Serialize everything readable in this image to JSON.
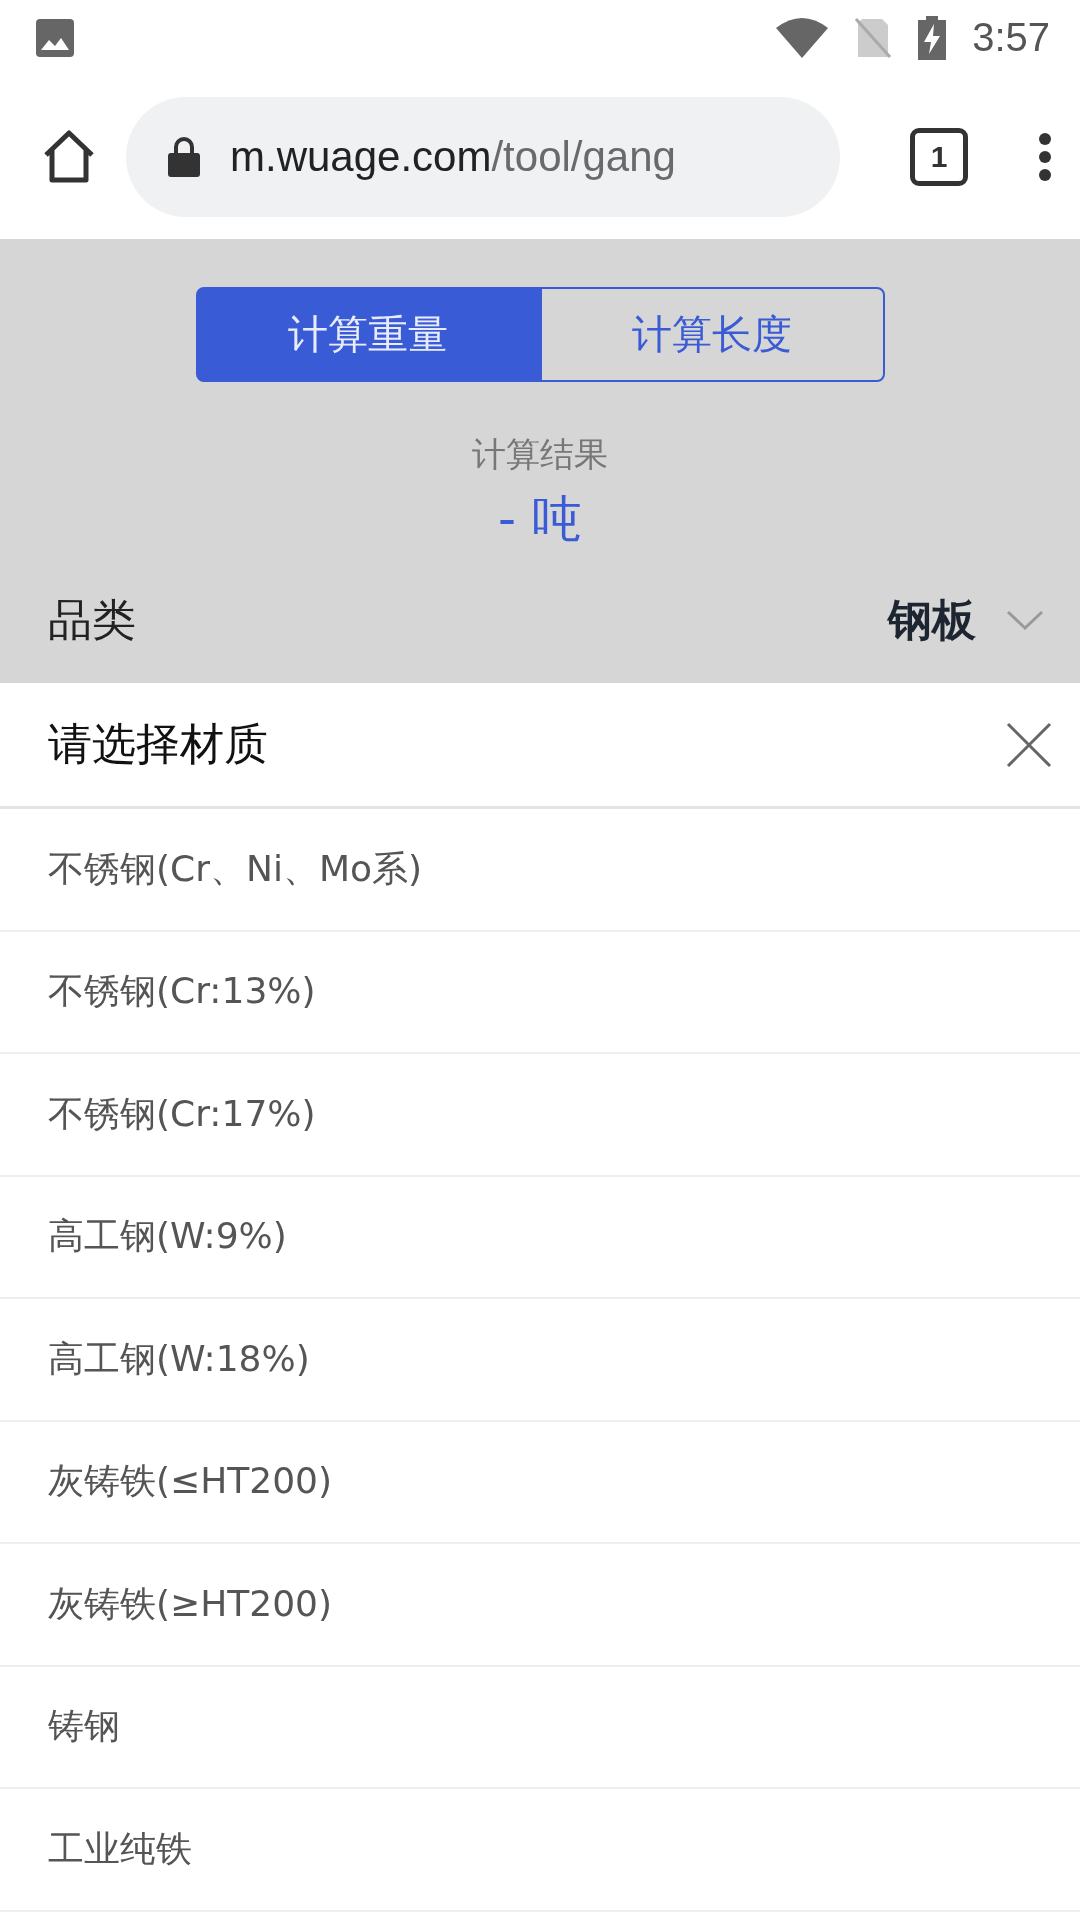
{
  "status_bar": {
    "time": "3:57"
  },
  "browser": {
    "url_host": "m.wuage.com",
    "url_path": "/tool/gang",
    "tab_count": "1"
  },
  "tabs": [
    {
      "label": "计算重量",
      "selected": true
    },
    {
      "label": "计算长度",
      "selected": false
    }
  ],
  "result": {
    "label": "计算结果",
    "value": "- 吨"
  },
  "category": {
    "label": "品类",
    "value": "钢板"
  },
  "sheet": {
    "title": "请选择材质",
    "options": [
      {
        "label": "不锈钢(Cr、Ni、Mo系)"
      },
      {
        "label": "不锈钢(Cr:13%)"
      },
      {
        "label": "不锈钢(Cr:17%)"
      },
      {
        "label": "高工钢(W:9%)"
      },
      {
        "label": "高工钢(W:18%)"
      },
      {
        "label": "灰铸铁(≤HT200)"
      },
      {
        "label": "灰铸铁(≥HT200)"
      },
      {
        "label": "铸钢"
      },
      {
        "label": "工业纯铁"
      }
    ]
  }
}
